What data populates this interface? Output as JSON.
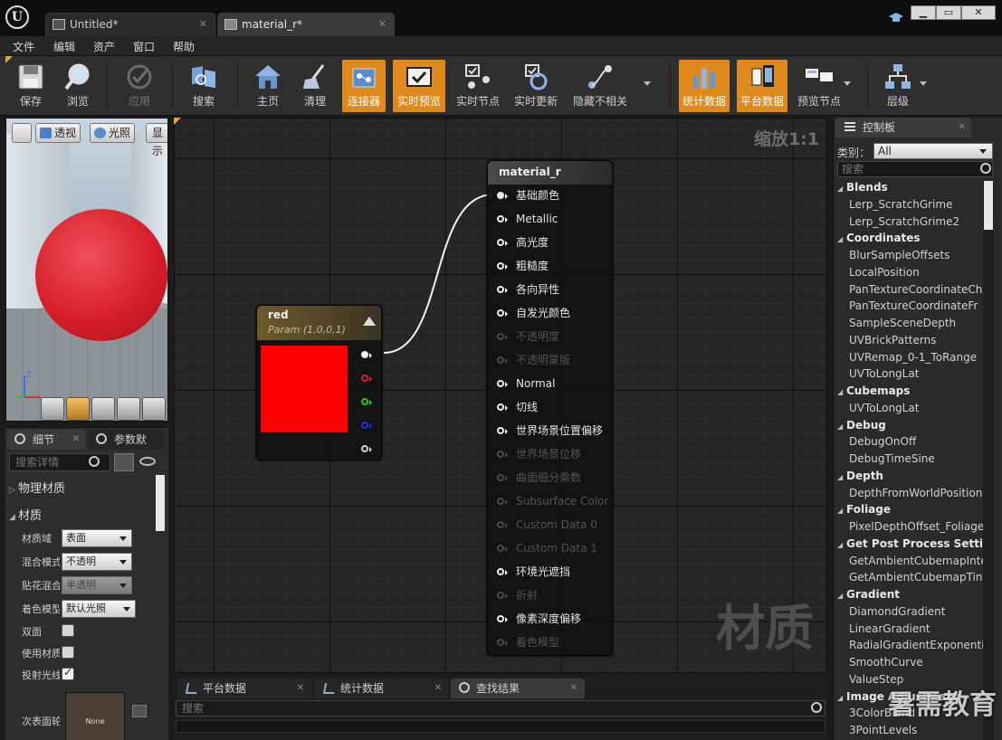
{
  "window": {
    "tabs": [
      {
        "label": "Untitled*"
      },
      {
        "label": "material_r*"
      }
    ],
    "minimize": "▁",
    "maximize": "▭",
    "close": "✕"
  },
  "menu": [
    "文件",
    "编辑",
    "资产",
    "窗口",
    "帮助"
  ],
  "toolbar": {
    "buttons": [
      {
        "label": "保存",
        "icon": "save-icon"
      },
      {
        "label": "浏览",
        "icon": "browse-icon"
      },
      {
        "label": "应用",
        "icon": "apply-icon"
      },
      {
        "label": "搜索",
        "icon": "search-icon"
      },
      {
        "label": "主页",
        "icon": "home-icon"
      },
      {
        "label": "清理",
        "icon": "clean-icon"
      },
      {
        "label": "连接器",
        "icon": "connector-icon"
      },
      {
        "label": "实时预览",
        "icon": "live-preview-icon"
      },
      {
        "label": "实时节点",
        "icon": "live-nodes-icon"
      },
      {
        "label": "实时更新",
        "icon": "live-update-icon"
      },
      {
        "label": "隐藏不相关",
        "icon": "hide-unrelated-icon"
      },
      {
        "label": "统计数据",
        "icon": "stats-icon"
      },
      {
        "label": "平台数据",
        "icon": "platform-stats-icon"
      },
      {
        "label": "预览节点",
        "icon": "preview-node-icon"
      },
      {
        "label": "层级",
        "icon": "hierarchy-icon"
      }
    ]
  },
  "viewport": {
    "perspective": "透视",
    "lit": "光照",
    "show": "显示"
  },
  "details": {
    "tabs": [
      "细节",
      "参数默"
    ],
    "search_placeholder": "搜索详情",
    "categories": [
      "物理材质",
      "材质"
    ],
    "properties": [
      {
        "label": "材质域",
        "value": "表面"
      },
      {
        "label": "混合模式",
        "value": "不透明"
      },
      {
        "label": "贴花混合",
        "value": "半透明"
      },
      {
        "label": "着色模型",
        "value": "默认光照"
      },
      {
        "label": "双面",
        "checked": false
      },
      {
        "label": "使用材质",
        "checked": false
      },
      {
        "label": "投射光线",
        "checked": true
      },
      {
        "label": "次表面轮",
        "value": "None"
      }
    ]
  },
  "graph": {
    "zoom": "缩放1:1",
    "watermark": "材质",
    "param_node": {
      "title": "red",
      "subtitle": "Param (1,0,0,1)",
      "color": "#ff0000"
    },
    "material_node": {
      "title": "material_r",
      "inputs": [
        {
          "label": "基础颜色",
          "enabled": true,
          "connected": true
        },
        {
          "label": "Metallic",
          "enabled": true
        },
        {
          "label": "高光度",
          "enabled": true
        },
        {
          "label": "粗糙度",
          "enabled": true
        },
        {
          "label": "各向异性",
          "enabled": true
        },
        {
          "label": "自发光颜色",
          "enabled": true
        },
        {
          "label": "不透明度",
          "enabled": false
        },
        {
          "label": "不透明蒙版",
          "enabled": false
        },
        {
          "label": "Normal",
          "enabled": true
        },
        {
          "label": "切线",
          "enabled": true
        },
        {
          "label": "世界场景位置偏移",
          "enabled": true
        },
        {
          "label": "世界场景位移",
          "enabled": false
        },
        {
          "label": "曲面细分乘数",
          "enabled": false
        },
        {
          "label": "Subsurface Color",
          "enabled": false
        },
        {
          "label": "Custom Data 0",
          "enabled": false
        },
        {
          "label": "Custom Data 1",
          "enabled": false
        },
        {
          "label": "环境光遮挡",
          "enabled": true
        },
        {
          "label": "折射",
          "enabled": false
        },
        {
          "label": "像素深度偏移",
          "enabled": true
        },
        {
          "label": "着色模型",
          "enabled": false
        }
      ]
    }
  },
  "bottom_tabs": [
    "平台数据",
    "统计数据",
    "查找结果"
  ],
  "bottom_search_placeholder": "搜索",
  "palette": {
    "tab": "控制板",
    "category_label": "类别：",
    "category_value": "All",
    "search_placeholder": "搜索",
    "rows": [
      {
        "type": "cat",
        "label": "Blends"
      },
      {
        "type": "item",
        "label": "Lerp_ScratchGrime"
      },
      {
        "type": "item",
        "label": "Lerp_ScratchGrime2"
      },
      {
        "type": "cat",
        "label": "Coordinates"
      },
      {
        "type": "item",
        "label": "BlurSampleOffsets"
      },
      {
        "type": "item",
        "label": "LocalPosition"
      },
      {
        "type": "item",
        "label": "PanTextureCoordinateCh"
      },
      {
        "type": "item",
        "label": "PanTextureCoordinateFr"
      },
      {
        "type": "item",
        "label": "SampleSceneDepth"
      },
      {
        "type": "item",
        "label": "UVBrickPatterns"
      },
      {
        "type": "item",
        "label": "UVRemap_0-1_ToRange"
      },
      {
        "type": "item",
        "label": "UVToLongLat"
      },
      {
        "type": "cat",
        "label": "Cubemaps"
      },
      {
        "type": "item",
        "label": "UVToLongLat"
      },
      {
        "type": "cat",
        "label": "Debug"
      },
      {
        "type": "item",
        "label": "DebugOnOff"
      },
      {
        "type": "item",
        "label": "DebugTimeSine"
      },
      {
        "type": "cat",
        "label": "Depth"
      },
      {
        "type": "item",
        "label": "DepthFromWorldPosition"
      },
      {
        "type": "cat",
        "label": "Foliage"
      },
      {
        "type": "item",
        "label": "PixelDepthOffset_Foliage"
      },
      {
        "type": "cat",
        "label": "Get Post Process Setting"
      },
      {
        "type": "item",
        "label": "GetAmbientCubemapInte"
      },
      {
        "type": "item",
        "label": "GetAmbientCubemapTint"
      },
      {
        "type": "cat",
        "label": "Gradient"
      },
      {
        "type": "item",
        "label": "DiamondGradient"
      },
      {
        "type": "item",
        "label": "LinearGradient"
      },
      {
        "type": "item",
        "label": "RadialGradientExponenti"
      },
      {
        "type": "item",
        "label": "SmoothCurve"
      },
      {
        "type": "item",
        "label": "ValueStep"
      },
      {
        "type": "cat",
        "label": "Image Adjustment"
      },
      {
        "type": "item",
        "label": "3ColorBlend"
      },
      {
        "type": "item",
        "label": "3PointLevels"
      }
    ]
  },
  "brand_watermark": "暑需教育"
}
